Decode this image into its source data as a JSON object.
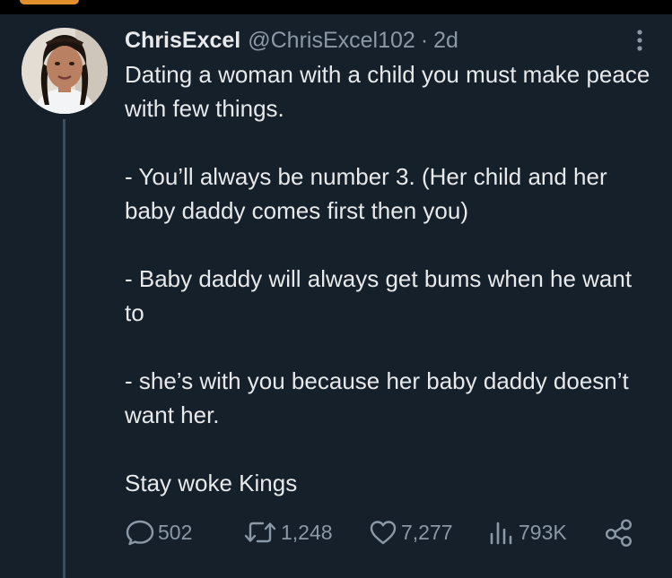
{
  "tweet": {
    "display_name": "ChrisExcel",
    "handle": "@ChrisExcel102",
    "separator": "·",
    "time": "2d",
    "paragraphs": [
      "Dating a woman with a child you must make peace with few things.",
      "- You’ll always be number 3. (Her child and her baby daddy comes first then you)",
      "- Baby daddy will always get bums when he want to",
      "- she’s with you because her baby daddy doesn’t want her.",
      "Stay woke Kings"
    ]
  },
  "actions": {
    "reply": {
      "icon": "reply-icon",
      "count": "502"
    },
    "retweet": {
      "icon": "retweet-icon",
      "count": "1,248"
    },
    "like": {
      "icon": "heart-icon",
      "count": "7,277"
    },
    "views": {
      "icon": "views-icon",
      "count": "793K"
    },
    "share": {
      "icon": "share-icon"
    }
  },
  "theme": {
    "background": "#15202b",
    "text": "#e7e9ea",
    "secondary_text": "#8b98a5"
  }
}
